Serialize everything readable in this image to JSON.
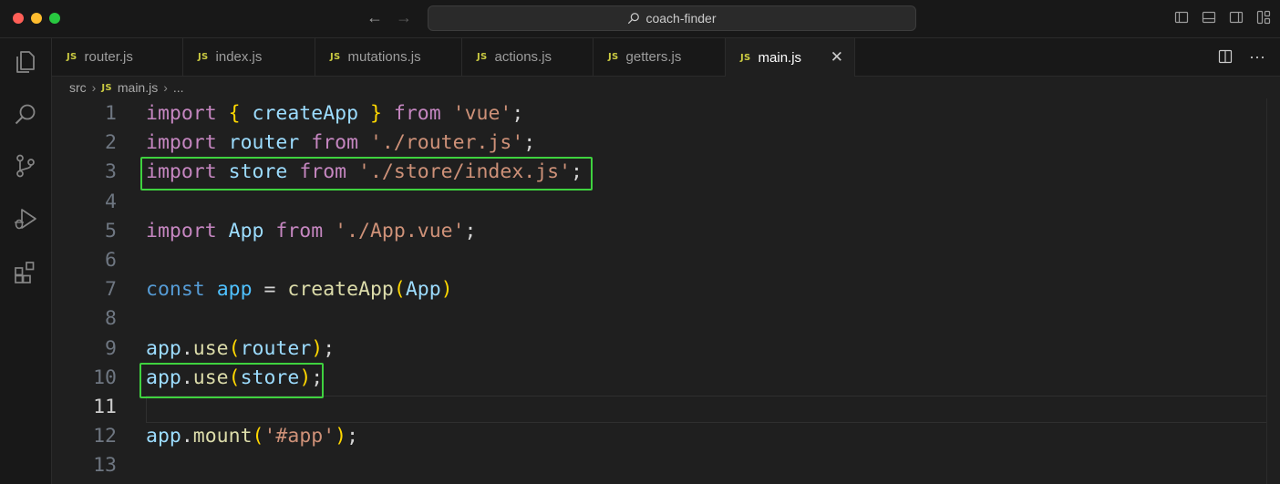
{
  "window": {
    "search_text": "coach-finder"
  },
  "tabs": [
    {
      "label": "router.js",
      "badge": "JS"
    },
    {
      "label": "index.js",
      "badge": "JS"
    },
    {
      "label": "mutations.js",
      "badge": "JS"
    },
    {
      "label": "actions.js",
      "badge": "JS"
    },
    {
      "label": "getters.js",
      "badge": "JS"
    },
    {
      "label": "main.js",
      "badge": "JS",
      "active": true
    }
  ],
  "breadcrumb": {
    "folder": "src",
    "file": "main.js",
    "symbol": "...",
    "badge": "JS"
  },
  "editor": {
    "current_line": 11,
    "highlighted_lines": [
      3,
      10
    ],
    "line_numbers": [
      "1",
      "2",
      "3",
      "4",
      "5",
      "6",
      "7",
      "8",
      "9",
      "10",
      "11",
      "12",
      "13"
    ],
    "lines": [
      [
        [
          "kw-i",
          "import"
        ],
        [
          "pun",
          " "
        ],
        [
          "br1",
          "{"
        ],
        [
          "pun",
          " "
        ],
        [
          "var",
          "createApp"
        ],
        [
          "pun",
          " "
        ],
        [
          "br1",
          "}"
        ],
        [
          "pun",
          " "
        ],
        [
          "kw-i",
          "from"
        ],
        [
          "pun",
          " "
        ],
        [
          "str",
          "'vue'"
        ],
        [
          "pun",
          ";"
        ]
      ],
      [
        [
          "kw-i",
          "import"
        ],
        [
          "pun",
          " "
        ],
        [
          "var",
          "router"
        ],
        [
          "pun",
          " "
        ],
        [
          "kw-i",
          "from"
        ],
        [
          "pun",
          " "
        ],
        [
          "str",
          "'./router.js'"
        ],
        [
          "pun",
          ";"
        ]
      ],
      [
        [
          "kw-i",
          "import"
        ],
        [
          "pun",
          " "
        ],
        [
          "var",
          "store"
        ],
        [
          "pun",
          " "
        ],
        [
          "kw-i",
          "from"
        ],
        [
          "pun",
          " "
        ],
        [
          "str",
          "'./store/index.js'"
        ],
        [
          "pun",
          ";"
        ]
      ],
      [],
      [
        [
          "kw-i",
          "import"
        ],
        [
          "pun",
          " "
        ],
        [
          "var",
          "App"
        ],
        [
          "pun",
          " "
        ],
        [
          "kw-i",
          "from"
        ],
        [
          "pun",
          " "
        ],
        [
          "str",
          "'./App.vue'"
        ],
        [
          "pun",
          ";"
        ]
      ],
      [],
      [
        [
          "kw-s",
          "const"
        ],
        [
          "pun",
          " "
        ],
        [
          "var-c",
          "app"
        ],
        [
          "pun",
          " = "
        ],
        [
          "fn",
          "createApp"
        ],
        [
          "br1",
          "("
        ],
        [
          "var",
          "App"
        ],
        [
          "br1",
          ")"
        ]
      ],
      [],
      [
        [
          "var",
          "app"
        ],
        [
          "pun",
          "."
        ],
        [
          "fn",
          "use"
        ],
        [
          "br1",
          "("
        ],
        [
          "var",
          "router"
        ],
        [
          "br1",
          ")"
        ],
        [
          "pun",
          ";"
        ]
      ],
      [
        [
          "var",
          "app"
        ],
        [
          "pun",
          "."
        ],
        [
          "fn",
          "use"
        ],
        [
          "br1",
          "("
        ],
        [
          "var",
          "store"
        ],
        [
          "br1",
          ")"
        ],
        [
          "pun",
          ";"
        ]
      ],
      [],
      [
        [
          "var",
          "app"
        ],
        [
          "pun",
          "."
        ],
        [
          "fn",
          "mount"
        ],
        [
          "br1",
          "("
        ],
        [
          "str",
          "'#app'"
        ],
        [
          "br1",
          ")"
        ],
        [
          "pun",
          ";"
        ]
      ],
      []
    ]
  },
  "colors": {
    "highlight_box": "#3fd23f",
    "editor_bg": "#1f1f1f",
    "keyword_import": "#c586c0",
    "string": "#ce9178"
  },
  "icons": {
    "activity": [
      "explorer-icon",
      "search-icon",
      "source-control-icon",
      "run-debug-icon",
      "extensions-icon"
    ],
    "titlebar": [
      "toggle-primary-sidebar-icon",
      "toggle-panel-icon",
      "toggle-secondary-sidebar-icon",
      "customize-layout-icon"
    ],
    "editor_actions": [
      "split-editor-icon",
      "more-actions-icon"
    ]
  }
}
